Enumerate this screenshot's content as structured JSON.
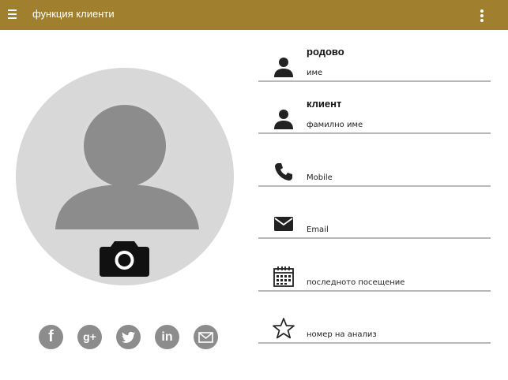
{
  "app_bar": {
    "title": "функция клиенти",
    "background_color": "#a0802f",
    "menu_icon": "hamburger-icon",
    "overflow_icon": "overflow-menu-icon"
  },
  "profile": {
    "avatar_icon": "person-silhouette-icon",
    "camera_icon": "camera-icon"
  },
  "social": [
    {
      "name": "facebook",
      "icon": "facebook-icon",
      "glyph": "f"
    },
    {
      "name": "google-plus",
      "icon": "google-plus-icon",
      "glyph": "g+"
    },
    {
      "name": "twitter",
      "icon": "twitter-icon",
      "glyph": ""
    },
    {
      "name": "linkedin",
      "icon": "linkedin-icon",
      "glyph": "in"
    },
    {
      "name": "email",
      "icon": "envelope-icon",
      "glyph": ""
    }
  ],
  "fields": [
    {
      "icon": "person-icon",
      "value": "родово",
      "label": "име"
    },
    {
      "icon": "person-icon",
      "value": "клиент",
      "label": "фамилно име"
    },
    {
      "icon": "phone-icon",
      "value": "",
      "label": "Mobile"
    },
    {
      "icon": "mail-icon",
      "value": "",
      "label": "Email"
    },
    {
      "icon": "calendar-icon",
      "value": "",
      "label": "последното посещение"
    },
    {
      "icon": "star-outline-icon",
      "value": "",
      "label": "номер на анализ"
    }
  ]
}
